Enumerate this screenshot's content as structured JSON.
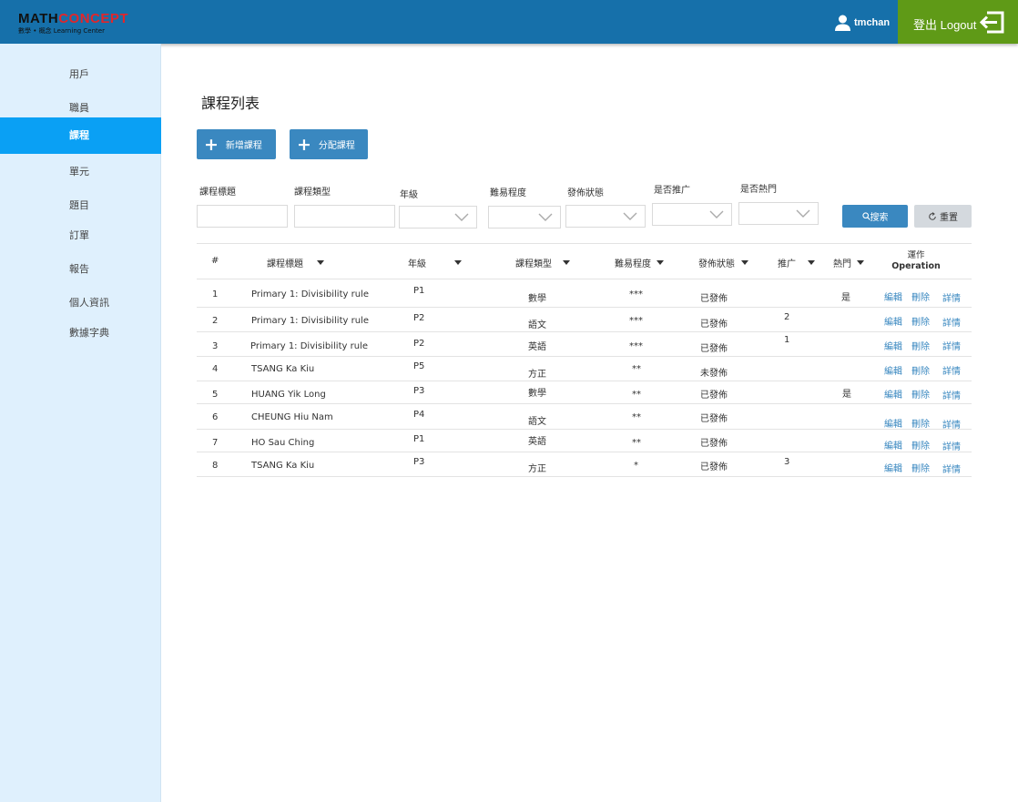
{
  "brand": {
    "name_a": "MATH",
    "name_b": "CONCEPT",
    "tagline": "數學 • 概念 Learning Center"
  },
  "header": {
    "username": "tmchan",
    "logout_label": "登出 Logout"
  },
  "sidebar": {
    "items": [
      {
        "label": "用戶"
      },
      {
        "label": "職員"
      },
      {
        "label": "課程",
        "active": true
      },
      {
        "label": "單元"
      },
      {
        "label": "題目"
      },
      {
        "label": "訂單"
      },
      {
        "label": "報告"
      },
      {
        "label": "個人資訊"
      },
      {
        "label": "數據字典"
      }
    ]
  },
  "page": {
    "title": "課程列表",
    "add_course_label": "新增課程",
    "assign_course_label": "分配課程"
  },
  "filters": {
    "title_label": "課程標題",
    "category_label": "課程類型",
    "grade_label": "年級",
    "difficulty_label": "難易程度",
    "status_label": "發佈狀態",
    "promote_label": "是否推广",
    "hot_label": "是否熱門",
    "search_label": "搜索",
    "reset_label": "重置"
  },
  "table": {
    "headers": {
      "index": "#",
      "title": "課程標題",
      "grade": "年級",
      "category": "課程類型",
      "difficulty": "難易程度",
      "status": "發佈狀態",
      "promote": "推广",
      "hot": "熱門",
      "op_cn": "運作",
      "op_en": "Operation"
    },
    "action_labels": {
      "edit": "編輯",
      "delete": "刪除",
      "detail": "詳情"
    },
    "rows": [
      {
        "idx": "1",
        "title": "Primary 1: Divisibility rule",
        "grade": "P1",
        "category": "數學",
        "difficulty": "***",
        "status": "已發佈",
        "promote": "",
        "hot": "是"
      },
      {
        "idx": "2",
        "title": "Primary 1: Divisibility rule",
        "grade": "P2",
        "category": "語文",
        "difficulty": "***",
        "status": "已發佈",
        "promote": "2",
        "hot": ""
      },
      {
        "idx": "3",
        "title": "Primary 1: Divisibility rule",
        "grade": "P2",
        "category": "英語",
        "difficulty": "***",
        "status": "已發佈",
        "promote": "1",
        "hot": ""
      },
      {
        "idx": "4",
        "title": "TSANG Ka Kiu",
        "grade": "P5",
        "category": "方正",
        "difficulty": "**",
        "status": "未發佈",
        "promote": "",
        "hot": ""
      },
      {
        "idx": "5",
        "title": "HUANG Yik Long",
        "grade": "P3",
        "category": "數學",
        "difficulty": "**",
        "status": "已發佈",
        "promote": "",
        "hot": "是"
      },
      {
        "idx": "6",
        "title": "CHEUNG Hiu Nam",
        "grade": "P4",
        "category": "語文",
        "difficulty": "**",
        "status": "已發佈",
        "promote": "",
        "hot": ""
      },
      {
        "idx": "7",
        "title": "HO Sau Ching",
        "grade": "P1",
        "category": "英語",
        "difficulty": "**",
        "status": "已發佈",
        "promote": "",
        "hot": ""
      },
      {
        "idx": "8",
        "title": "TSANG Ka Kiu",
        "grade": "P3",
        "category": "方正",
        "difficulty": "*",
        "status": "已發佈",
        "promote": "3",
        "hot": ""
      }
    ]
  },
  "colors": {
    "header_bg": "#1670aa",
    "logout_bg": "#5f9a17",
    "sidebar_bg": "#dff0fd",
    "sidebar_active": "#0aa0f4",
    "button_blue": "#3a88c0",
    "link": "#3a88c0"
  },
  "icons": {
    "user": "user-icon",
    "logout": "logout-arrow-icon",
    "plus": "plus-icon",
    "search": "search-icon",
    "reset": "refresh-icon",
    "chevron": "chevron-down-icon",
    "sort": "sort-triangle-icon"
  }
}
